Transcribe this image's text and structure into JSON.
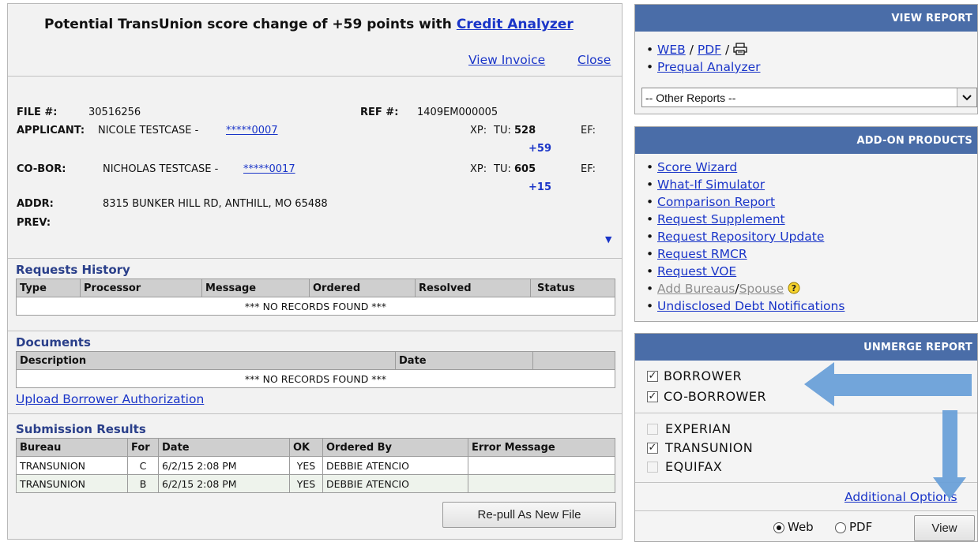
{
  "left": {
    "headline": {
      "prefix": "Potential TransUnion score change of +59 points with",
      "link": "Credit Analyzer"
    },
    "links": {
      "view_invoice": "View Invoice",
      "close": "Close"
    },
    "file": {
      "file_label": "FILE #:",
      "file_value": "30516256",
      "ref_label": "REF #:",
      "ref_value": "1409EM000005",
      "applicant_label": "APPLICANT:",
      "applicant_name": "NICOLE TESTCASE -",
      "applicant_ssn": "*****0007",
      "coborrower_label": "CO-BOR:",
      "coborrower_name": "NICHOLAS TESTCASE -",
      "coborrower_ssn": "*****0017",
      "addr_label": "ADDR:",
      "addr_value": "8315 BUNKER HILL RD, ANTHILL, MO 65488",
      "prev_label": "PREV:",
      "xp_label": "XP:",
      "tu_label": "TU:",
      "ef_label": "EF:",
      "applicant_tu": "528",
      "applicant_tu_change": "+59",
      "coborrower_tu": "605",
      "coborrower_tu_change": "+15",
      "expand_icon": "triangle-down-icon"
    },
    "requests_history": {
      "title": "Requests History",
      "columns": [
        "Type",
        "Processor",
        "Message",
        "Ordered",
        "Resolved",
        "Status"
      ],
      "empty": "*** NO RECORDS FOUND ***"
    },
    "documents": {
      "title": "Documents",
      "columns": [
        "Description",
        "Date"
      ],
      "empty": "*** NO RECORDS FOUND ***",
      "upload_link": "Upload Borrower Authorization"
    },
    "submission_results": {
      "title": "Submission Results",
      "columns": [
        "Bureau",
        "For",
        "Date",
        "OK",
        "Ordered By",
        "Error Message"
      ],
      "rows": [
        [
          "TRANSUNION",
          "C",
          "6/2/15 2:08 PM",
          "YES",
          "DEBBIE ATENCIO",
          ""
        ],
        [
          "TRANSUNION",
          "B",
          "6/2/15 2:08 PM",
          "YES",
          "DEBBIE ATENCIO",
          ""
        ]
      ]
    },
    "repull_button": "Re-pull As New File"
  },
  "view_report": {
    "header": "VIEW REPORT",
    "web": "WEB",
    "slash1": "/",
    "pdf": "PDF",
    "slash2": "/",
    "print_icon": "printer-icon",
    "prequal": "Prequal Analyzer",
    "other_reports": "-- Other Reports --"
  },
  "addon": {
    "header": "ADD-ON PRODUCTS",
    "items": [
      "Score Wizard",
      "What-If Simulator",
      "Comparison Report",
      "Request Supplement",
      "Request Repository Update",
      "Request RMCR",
      "Request VOE"
    ],
    "add_bureaus": "Add Bureaus",
    "slash": "/",
    "spouse": "Spouse",
    "help_icon": "question-circle-icon",
    "undisclosed": "Undisclosed Debt Notifications"
  },
  "unmerge": {
    "header": "UNMERGE REPORT",
    "borrower": "BORROWER",
    "coborrower": "CO-BORROWER",
    "experian": "EXPERIAN",
    "transunion": "TRANSUNION",
    "equifax": "EQUIFAX",
    "additional": "Additional Options",
    "web": "Web",
    "pdf": "PDF",
    "view": "View",
    "states": {
      "borrower": true,
      "coborrower": true,
      "experian": false,
      "transunion": true,
      "equifax": false,
      "format": "Web"
    },
    "annotation_color": "#6aa0d8"
  }
}
